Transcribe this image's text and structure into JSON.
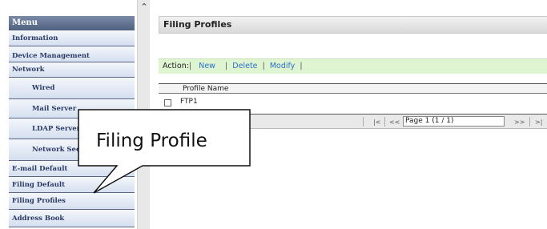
{
  "sidebar": {
    "header": "Menu",
    "items": [
      {
        "label": "Information",
        "sub": false
      },
      {
        "label": "Device Management",
        "sub": false
      },
      {
        "label": "Network",
        "sub": false
      },
      {
        "label": "Wired",
        "sub": true
      },
      {
        "label": "Mail Server",
        "sub": true
      },
      {
        "label": "LDAP Server",
        "sub": true
      },
      {
        "label": "Network Security",
        "sub": true
      },
      {
        "label": "E-mail Default",
        "sub": false
      },
      {
        "label": "Filing Default",
        "sub": false
      },
      {
        "label": "Filing Profiles",
        "sub": false
      },
      {
        "label": "Address Book",
        "sub": false
      }
    ]
  },
  "scroll_icon": "scroll-up-arrow-icon",
  "page": {
    "title": "Filing Profiles",
    "action_label": "Action:",
    "actions": {
      "new": "New",
      "delete": "Delete",
      "modify": "Modify"
    },
    "table": {
      "column_header": "Profile Name",
      "rows": [
        {
          "name": "FTP1",
          "checked": false
        }
      ]
    },
    "pager": {
      "first": "|<",
      "prev": "<<",
      "page_text": "Page 1 (1 / 1)",
      "next": ">>",
      "last": ">|"
    }
  },
  "callout": {
    "text": "Filing Profile"
  }
}
